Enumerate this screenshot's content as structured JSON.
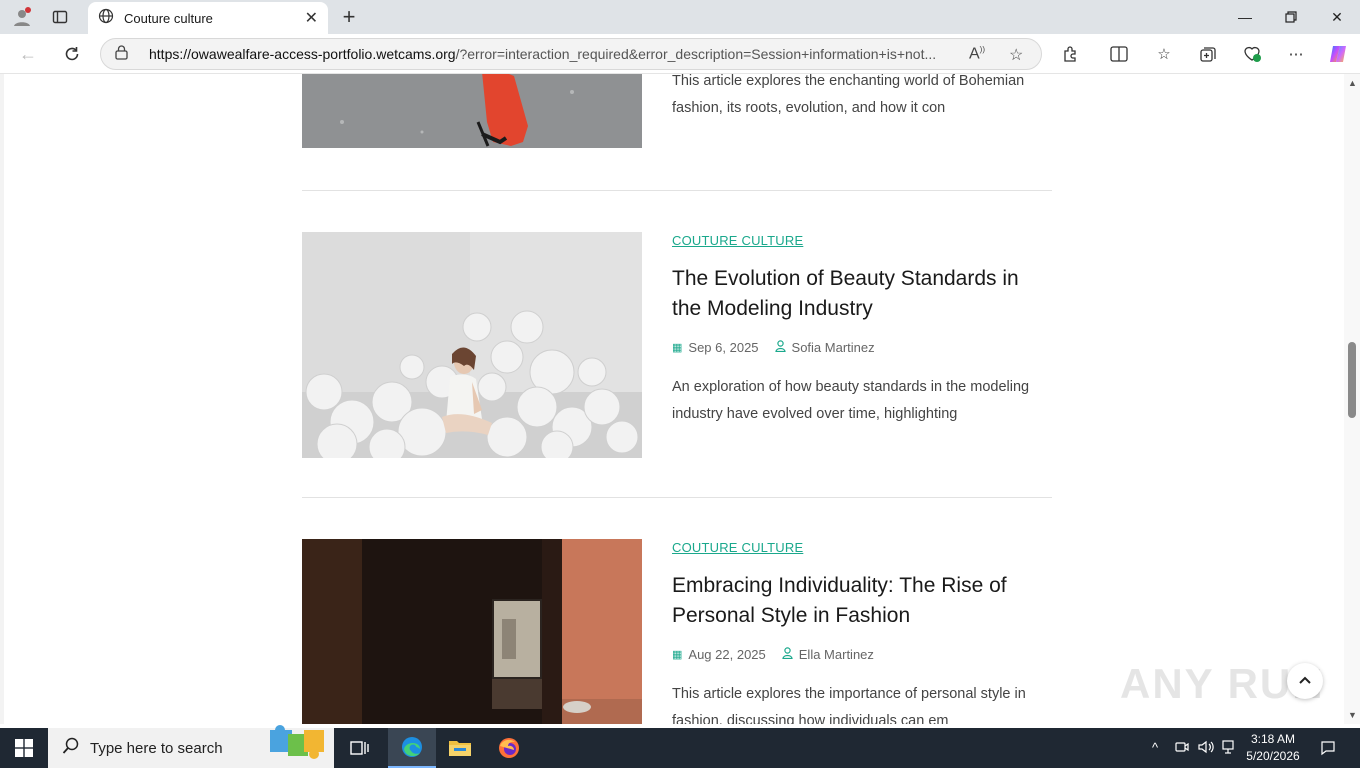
{
  "browser": {
    "tab_title": "Couture culture",
    "url_domain": "https://owawealfare-access-portfolio.wetcams.org",
    "url_rest": "/?error=interaction_required&error_description=Session+information+is+not..."
  },
  "posts": [
    {
      "excerpt": "This article explores the enchanting world of Bohemian fashion, its roots, evolution, and how it con"
    },
    {
      "category": "COUTURE CULTURE",
      "title": "The Evolution of Beauty Standards in the Modeling Industry",
      "date": "Sep 6, 2025",
      "author": "Sofia Martinez",
      "excerpt": "An exploration of how beauty standards in the modeling industry have evolved over time, highlighting"
    },
    {
      "category": "COUTURE CULTURE",
      "title": "Embracing Individuality: The Rise of Personal Style in Fashion",
      "date": "Aug 22, 2025",
      "author": "Ella Martinez",
      "excerpt": "This article explores the importance of personal style in fashion, discussing how individuals can em"
    }
  ],
  "watermark": "ANY RUN",
  "taskbar": {
    "search_placeholder": "Type here to search",
    "time": "3:18 AM",
    "date": "5/20/2026"
  },
  "colors": {
    "accent": "#1aa88c",
    "taskbar": "#1f2833"
  },
  "icons": [
    "profile-icon",
    "tab-actions-icon",
    "globe-icon",
    "close-icon",
    "plus-icon",
    "minimize-icon",
    "restore-icon",
    "back-icon",
    "refresh-icon",
    "lock-icon",
    "read-aloud-icon",
    "favorite-icon",
    "extensions-icon",
    "split-screen-icon",
    "favorites-icon",
    "collections-icon",
    "performance-icon",
    "more-icon",
    "copilot-icon",
    "calendar-icon",
    "user-icon",
    "chevron-up-icon",
    "windows-icon",
    "search-icon",
    "task-view-icon",
    "edge-icon",
    "file-explorer-icon",
    "firefox-icon"
  ]
}
